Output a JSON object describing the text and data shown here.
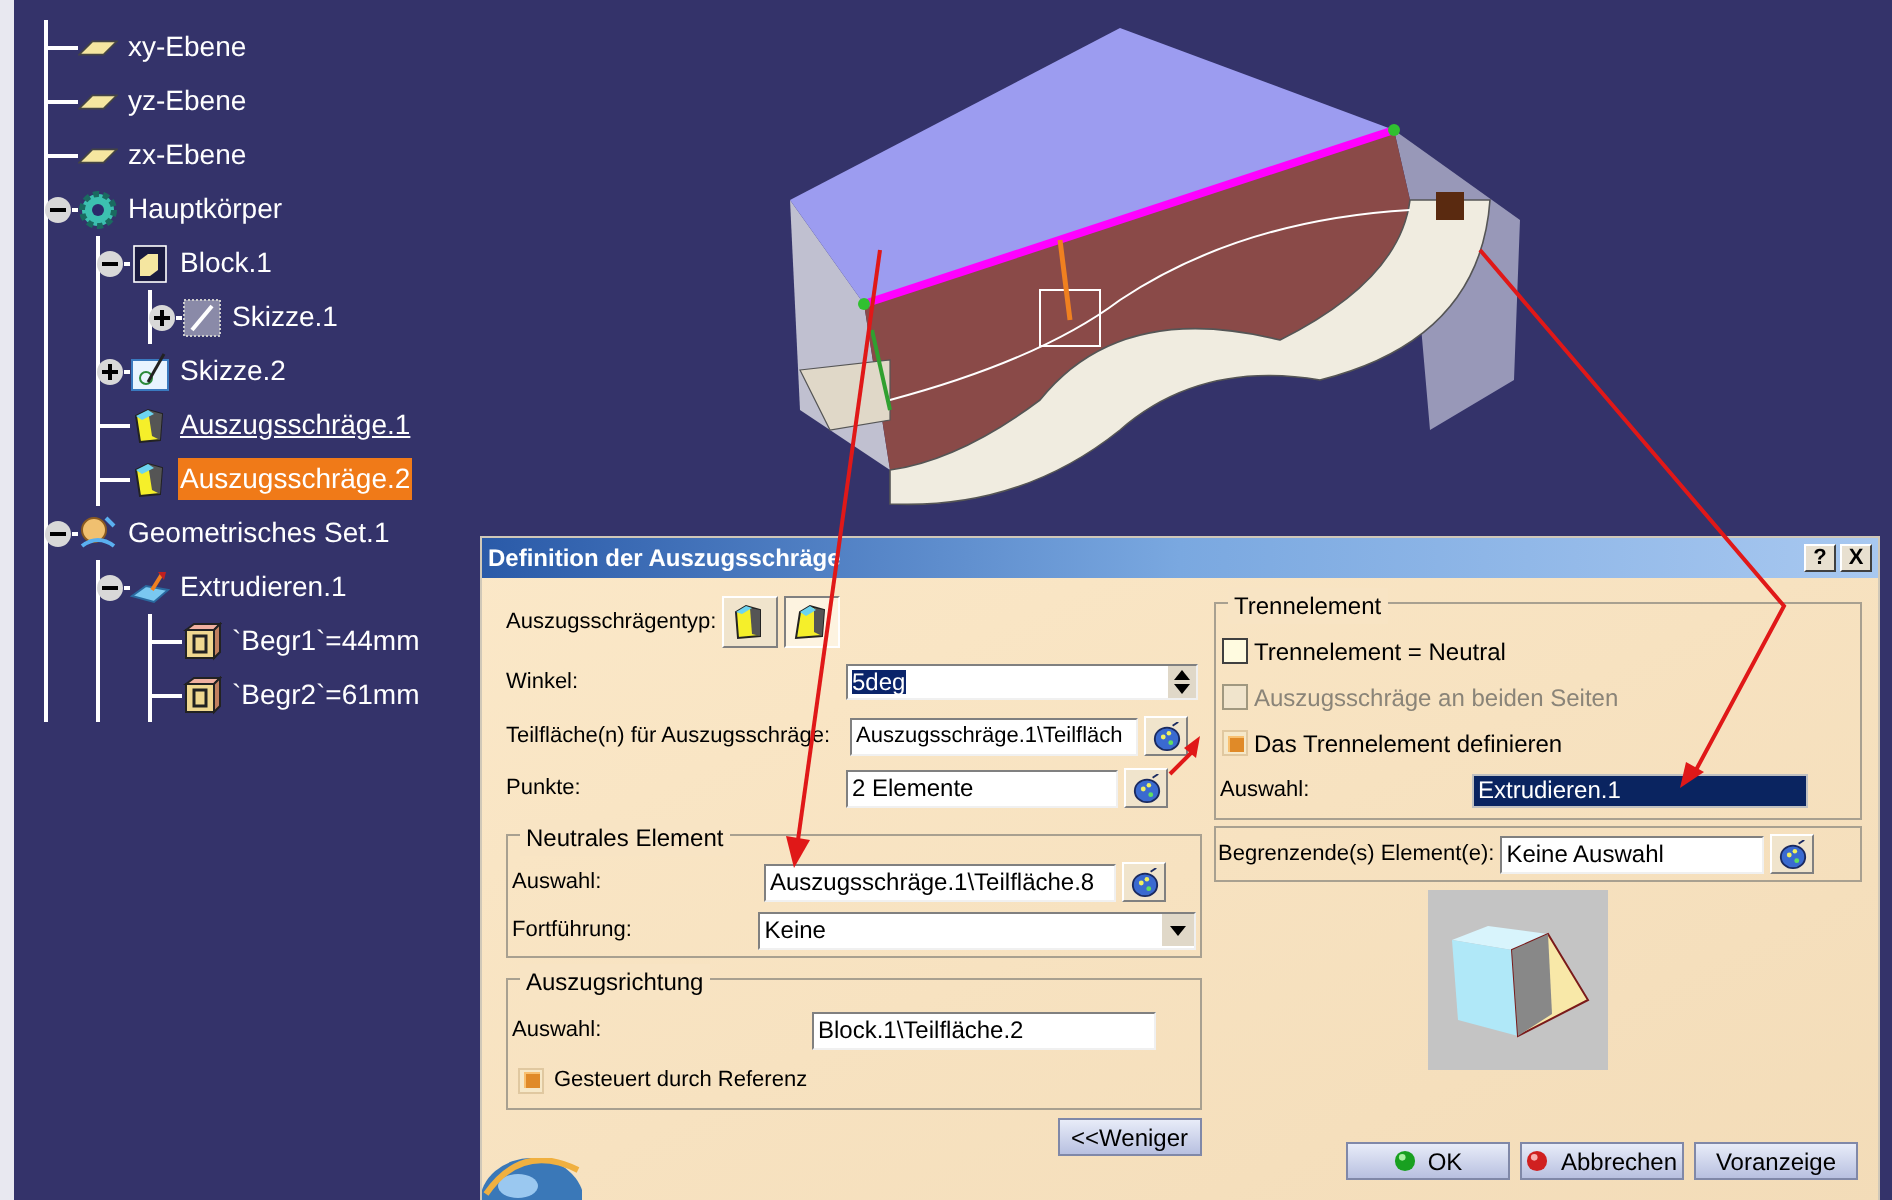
{
  "tree": [
    {
      "label": "xy-Ebene",
      "kind": "plane",
      "selected": false,
      "underlined": false
    },
    {
      "label": "yz-Ebene",
      "kind": "plane",
      "selected": false,
      "underlined": false
    },
    {
      "label": "zx-Ebene",
      "kind": "plane",
      "selected": false,
      "underlined": false
    },
    {
      "label": "Hauptkörper",
      "kind": "body",
      "expanded": true,
      "selected": false,
      "underlined": false,
      "children": [
        {
          "label": "Block.1",
          "kind": "block",
          "expanded": true,
          "selected": false,
          "underlined": false,
          "children": [
            {
              "label": "Skizze.1",
              "kind": "hatched",
              "expanded": false,
              "selected": false,
              "underlined": false
            }
          ]
        },
        {
          "label": "Skizze.2",
          "kind": "sketch",
          "expanded": false,
          "selected": false,
          "underlined": false
        },
        {
          "label": "Auszugsschräge.1",
          "kind": "draft",
          "selected": false,
          "underlined": true
        },
        {
          "label": "Auszugsschräge.2",
          "kind": "draft",
          "selected": true,
          "underlined": false
        }
      ]
    },
    {
      "label": "Geometrisches Set.1",
      "kind": "set",
      "expanded": true,
      "selected": false,
      "underlined": false,
      "children": [
        {
          "label": "Extrudieren.1",
          "kind": "extrude",
          "expanded": true,
          "selected": false,
          "underlined": false,
          "children": [
            {
              "label": "`Begr1`=44mm",
              "kind": "parameter",
              "selected": false,
              "underlined": false
            },
            {
              "label": "`Begr2`=61mm",
              "kind": "parameter",
              "selected": false,
              "underlined": false
            }
          ]
        }
      ]
    }
  ],
  "dialog": {
    "title": "Definition der Auszugsschräge",
    "title_buttons": [
      "?",
      "X"
    ],
    "type_label": "Auszugsschrägentyp:",
    "type_options": [
      {
        "kind": "straight",
        "selected": false
      },
      {
        "kind": "curved",
        "selected": true
      }
    ],
    "angle": {
      "label": "Winkel:",
      "value": "5deg",
      "value_selected": true
    },
    "faces": {
      "label": "Teilfläche(n) für Auszugsschräge:",
      "value": "Auszugsschräge.1\\Teilfläch"
    },
    "points": {
      "label": "Punkte:",
      "value": "2 Elemente"
    },
    "neutral": {
      "title": "Neutrales Element",
      "selection": {
        "label": "Auswahl:",
        "value": "Auszugsschräge.1\\Teilfläche.8"
      },
      "continuation": {
        "label": "Fortführung:",
        "value": "Keine"
      }
    },
    "direction": {
      "title": "Auszugsrichtung",
      "selection": {
        "label": "Auswahl:",
        "value": "Block.1\\Teilfläche.2"
      },
      "checkbox": {
        "label": "Gesteuert durch Referenz",
        "checked": true
      }
    },
    "less_button": "<<Weniger",
    "separation": {
      "title": "Trennelement",
      "options": [
        {
          "label": "Trennelement = Neutral",
          "checked": false,
          "disabled": false
        },
        {
          "label": "Auszugsschräge an beiden Seiten",
          "checked": false,
          "disabled": true
        },
        {
          "label": "Das Trennelement definieren",
          "checked": true,
          "disabled": false
        }
      ],
      "selection": {
        "label": "Auswahl:",
        "value": "Extrudieren.1",
        "highlighted": true
      }
    },
    "limiting": {
      "label": "Begrenzende(s) Element(e):",
      "value": "Keine Auswahl"
    },
    "buttons": [
      {
        "label": "OK",
        "kind": "ok"
      },
      {
        "label": "Abbrechen",
        "kind": "cancel"
      },
      {
        "label": "Voranzeige",
        "kind": "preview"
      }
    ]
  }
}
